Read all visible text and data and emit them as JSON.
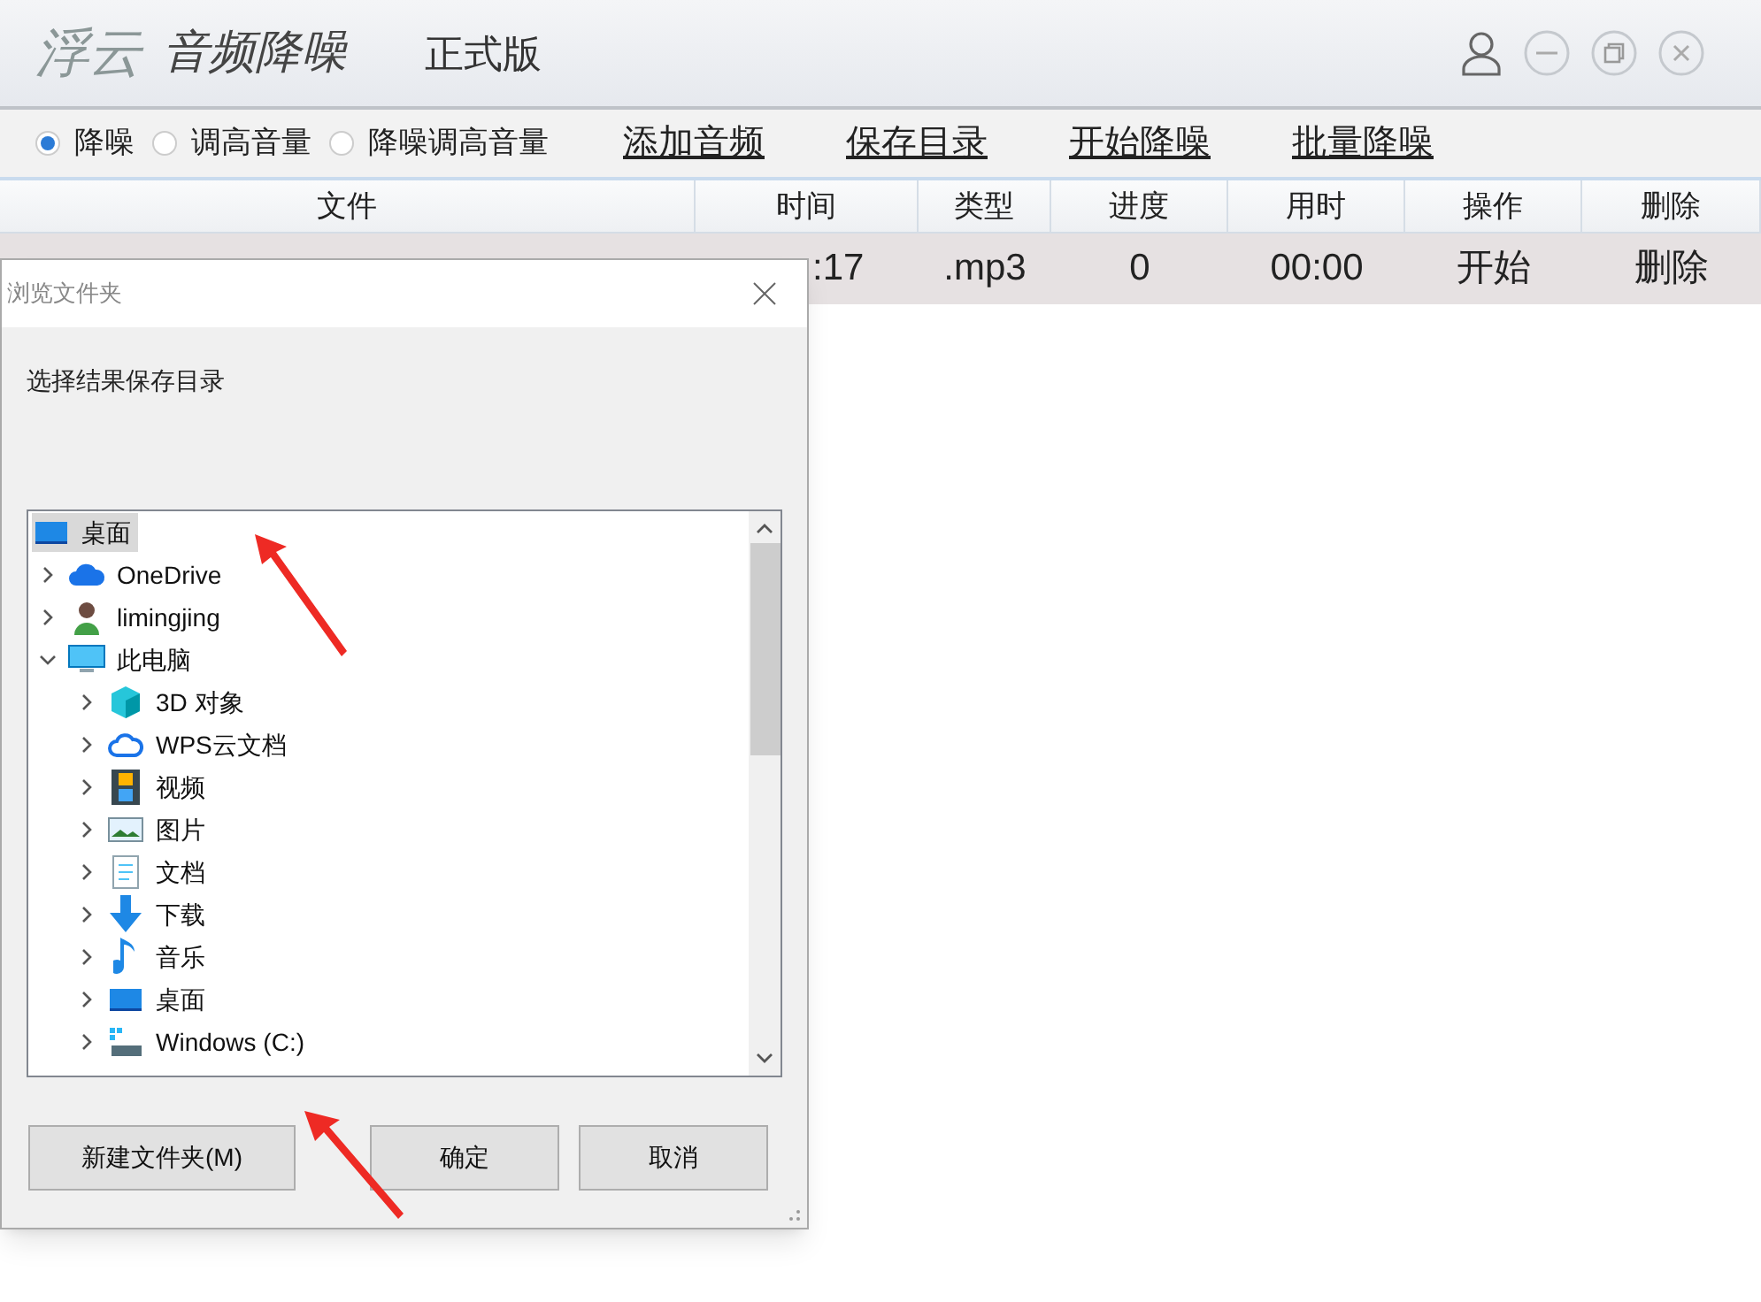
{
  "app": {
    "logo": "浮云",
    "title": "音频降噪",
    "edition": "正式版"
  },
  "modes": [
    {
      "label": "降噪",
      "selected": true
    },
    {
      "label": "调高音量",
      "selected": false
    },
    {
      "label": "降噪调高音量",
      "selected": false
    }
  ],
  "actions": [
    "添加音频",
    "保存目录",
    "开始降噪",
    "批量降噪"
  ],
  "table": {
    "columns": [
      "文件",
      "时间",
      "类型",
      "进度",
      "用时",
      "操作",
      "删除"
    ],
    "rows": [
      {
        "time": ":17",
        "type": ".mp3",
        "progress": "0",
        "elapsed": "00:00",
        "action": "开始",
        "delete": "删除"
      }
    ]
  },
  "dialog": {
    "title": "浏览文件夹",
    "prompt": "选择结果保存目录",
    "tree": [
      {
        "label": "桌面",
        "selected": true,
        "children": [
          {
            "label": "OneDrive",
            "expanded": false
          },
          {
            "label": "limingjing",
            "expanded": false
          },
          {
            "label": "此电脑",
            "expanded": true,
            "children": [
              {
                "label": "3D 对象",
                "expanded": false
              },
              {
                "label": "WPS云文档",
                "expanded": false
              },
              {
                "label": "视频",
                "expanded": false
              },
              {
                "label": "图片",
                "expanded": false
              },
              {
                "label": "文档",
                "expanded": false
              },
              {
                "label": "下载",
                "expanded": false
              },
              {
                "label": "音乐",
                "expanded": false
              },
              {
                "label": "桌面",
                "expanded": false
              },
              {
                "label": "Windows (C:)",
                "expanded": false
              }
            ]
          }
        ]
      }
    ],
    "buttons": [
      "新建文件夹(M)",
      "确定",
      "取消"
    ]
  }
}
